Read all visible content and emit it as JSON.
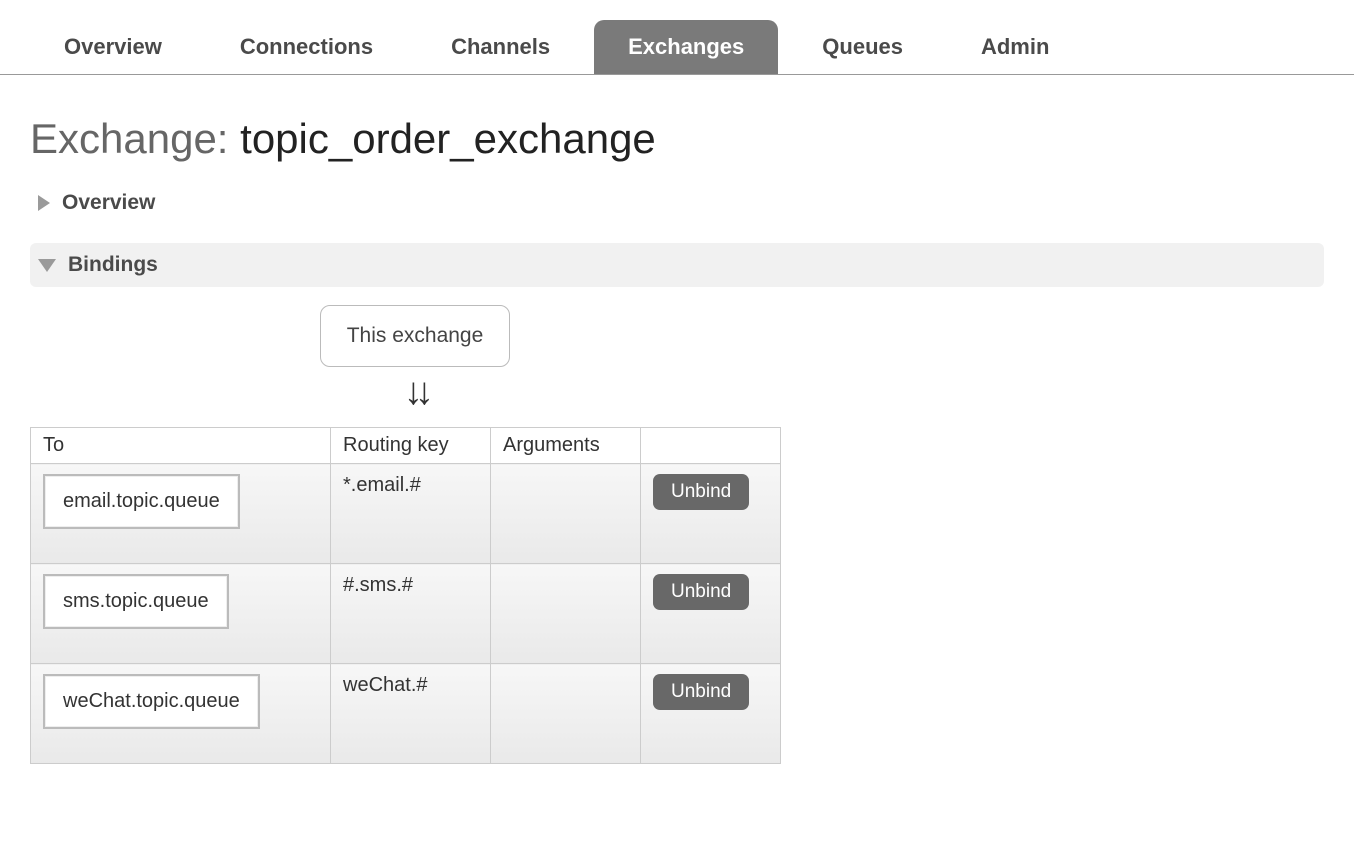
{
  "tabs": {
    "items": [
      {
        "label": "Overview",
        "active": false
      },
      {
        "label": "Connections",
        "active": false
      },
      {
        "label": "Channels",
        "active": false
      },
      {
        "label": "Exchanges",
        "active": true
      },
      {
        "label": "Queues",
        "active": false
      },
      {
        "label": "Admin",
        "active": false
      }
    ]
  },
  "page": {
    "title_prefix": "Exchange:",
    "exchange_name": "topic_order_exchange"
  },
  "sections": {
    "overview_label": "Overview",
    "bindings_label": "Bindings"
  },
  "bindings": {
    "this_exchange_label": "This exchange",
    "columns": {
      "to": "To",
      "routing_key": "Routing key",
      "arguments": "Arguments"
    },
    "unbind_label": "Unbind",
    "rows": [
      {
        "to": "email.topic.queue",
        "routing_key": "*.email.#",
        "arguments": ""
      },
      {
        "to": "sms.topic.queue",
        "routing_key": "#.sms.#",
        "arguments": ""
      },
      {
        "to": "weChat.topic.queue",
        "routing_key": "weChat.#",
        "arguments": ""
      }
    ]
  }
}
